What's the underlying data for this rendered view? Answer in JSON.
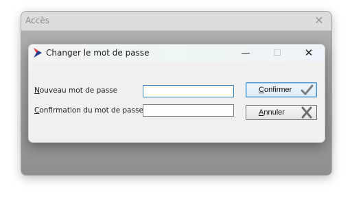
{
  "outer_window": {
    "title": "Accès",
    "close_glyph": "✕"
  },
  "dialog": {
    "title": "Changer le mot de passe",
    "icon": "app-logo-icon",
    "controls": {
      "minimize_glyph": "—",
      "maximize_glyph": "☐",
      "close_glyph": "✕"
    }
  },
  "form": {
    "new_password": {
      "label_access_key": "N",
      "label_rest": "ouveau mot de passe",
      "value": ""
    },
    "confirm_password": {
      "label_access_key": "C",
      "label_rest": "onfirmation du mot de passe",
      "value": ""
    }
  },
  "buttons": {
    "confirm": {
      "label_access_key": "C",
      "label_rest": "onfirmer",
      "icon": "checkmark-icon"
    },
    "cancel": {
      "label_access_key": "A",
      "label_rest": "nnuler",
      "icon": "cross-icon"
    }
  },
  "colors": {
    "logo_red": "#e53935",
    "logo_blue": "#1e3a8a",
    "focus_blue": "#3a84c2"
  }
}
